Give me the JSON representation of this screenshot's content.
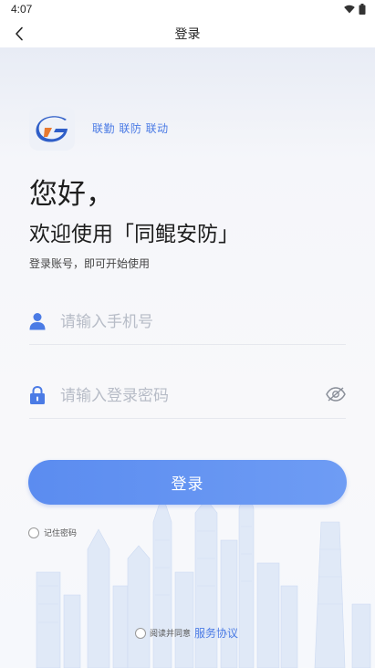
{
  "status_bar": {
    "time": "4:07"
  },
  "nav": {
    "title": "登录"
  },
  "brand": {
    "slogan": "联勤 联防 联动"
  },
  "greeting": {
    "hello": "您好，",
    "welcome": "欢迎使用「同鲲安防」",
    "subtitle": "登录账号，即可开始使用"
  },
  "form": {
    "phone_placeholder": "请输入手机号",
    "phone_value": "",
    "password_placeholder": "请输入登录密码",
    "password_value": "",
    "login_label": "登录",
    "remember_label": "记住密码",
    "remember_checked": false
  },
  "agreement": {
    "prefix": "阅读并同意",
    "link": "服务协议",
    "checked": false
  },
  "colors": {
    "accent": "#4b7be5",
    "button": "#6e9cf4"
  },
  "icons": {
    "back": "chevron-left-icon",
    "user": "user-icon",
    "lock": "lock-icon",
    "eye": "eye-icon",
    "wifi": "wifi-icon",
    "battery": "battery-icon"
  }
}
